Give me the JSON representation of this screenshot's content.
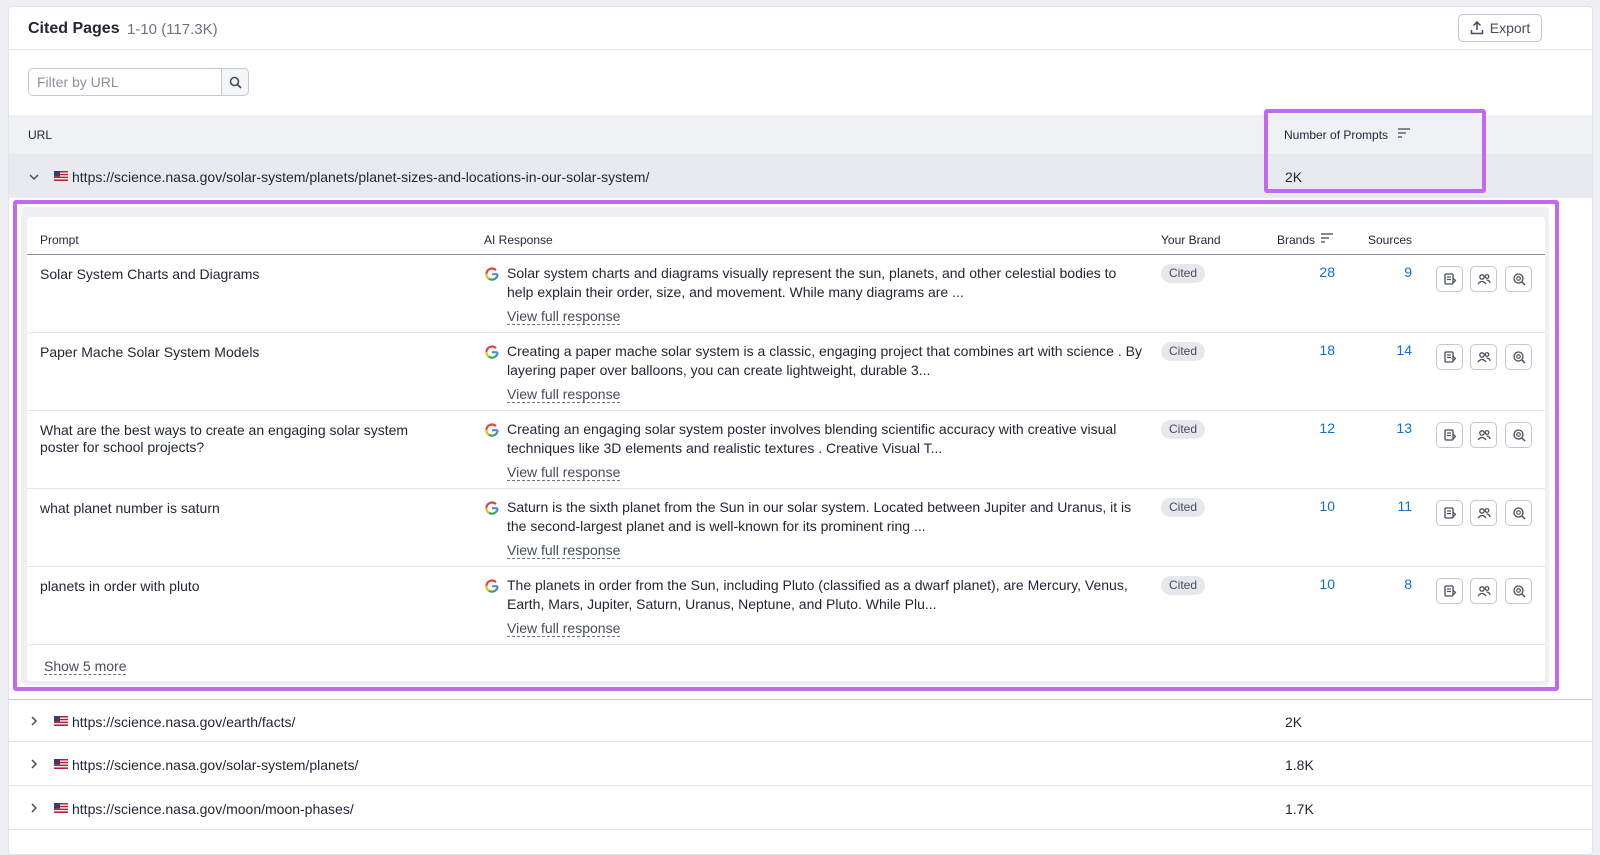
{
  "header": {
    "title": "Cited Pages",
    "range": "1-10 (117.3K)",
    "export_label": "Export"
  },
  "filter": {
    "placeholder": "Filter by URL",
    "value": ""
  },
  "table": {
    "col_url": "URL",
    "col_prompts": "Number of Prompts"
  },
  "expanded": {
    "url": "https://science.nasa.gov/solar-system/planets/planet-sizes-and-locations-in-our-solar-system/",
    "prompts": "2K",
    "sub_headers": {
      "prompt": "Prompt",
      "ai_response": "AI Response",
      "your_brand": "Your Brand",
      "brands": "Brands",
      "sources": "Sources"
    },
    "rows": [
      {
        "prompt": "Solar System Charts and Diagrams",
        "response": "Solar system charts and diagrams visually represent the sun, planets, and other celestial bodies to help explain their order, size, and movement. While many diagrams are ...",
        "link": "View full response",
        "brand": "Cited",
        "brands": "28",
        "sources": "9"
      },
      {
        "prompt": "Paper Mache Solar System Models",
        "response": "Creating a paper mache solar system is a classic, engaging project that combines art with science . By layering paper over balloons, you can create lightweight, durable 3...",
        "link": "View full response",
        "brand": "Cited",
        "brands": "18",
        "sources": "14"
      },
      {
        "prompt": "What are the best ways to create an engaging solar system poster for school projects?",
        "response": "Creating an engaging solar system poster involves blending scientific accuracy with creative visual techniques like 3D elements and realistic textures . Creative Visual T...",
        "link": "View full response",
        "brand": "Cited",
        "brands": "12",
        "sources": "13"
      },
      {
        "prompt": "what planet number is saturn",
        "response": "Saturn is the sixth planet from the Sun in our solar system. Located between Jupiter and Uranus, it is the second-largest planet and is well-known for its prominent ring ...",
        "link": "View full response",
        "brand": "Cited",
        "brands": "10",
        "sources": "11"
      },
      {
        "prompt": "planets in order with pluto",
        "response": "The planets in order from the Sun, including Pluto (classified as a dwarf planet), are Mercury, Venus, Earth, Mars, Jupiter, Saturn, Uranus, Neptune, and Pluto. While Plu...",
        "link": "View full response",
        "brand": "Cited",
        "brands": "10",
        "sources": "8"
      }
    ],
    "show_more": "Show 5 more"
  },
  "collapsed_rows": [
    {
      "url": "https://science.nasa.gov/earth/facts/",
      "prompts": "2K"
    },
    {
      "url": "https://science.nasa.gov/solar-system/planets/",
      "prompts": "1.8K"
    },
    {
      "url": "https://science.nasa.gov/moon/moon-phases/",
      "prompts": "1.7K"
    }
  ],
  "colors": {
    "link": "#0d6fd1",
    "highlight": "#c06af0",
    "header_bg": "#f0f1f4",
    "expanded_bg": "#e8eaef"
  },
  "icons": [
    "export-icon",
    "search-icon",
    "chevron-down-icon",
    "chevron-right-icon",
    "us-flag-icon",
    "sort-icon",
    "google-icon",
    "document-icon",
    "users-icon",
    "zoom-icon"
  ]
}
